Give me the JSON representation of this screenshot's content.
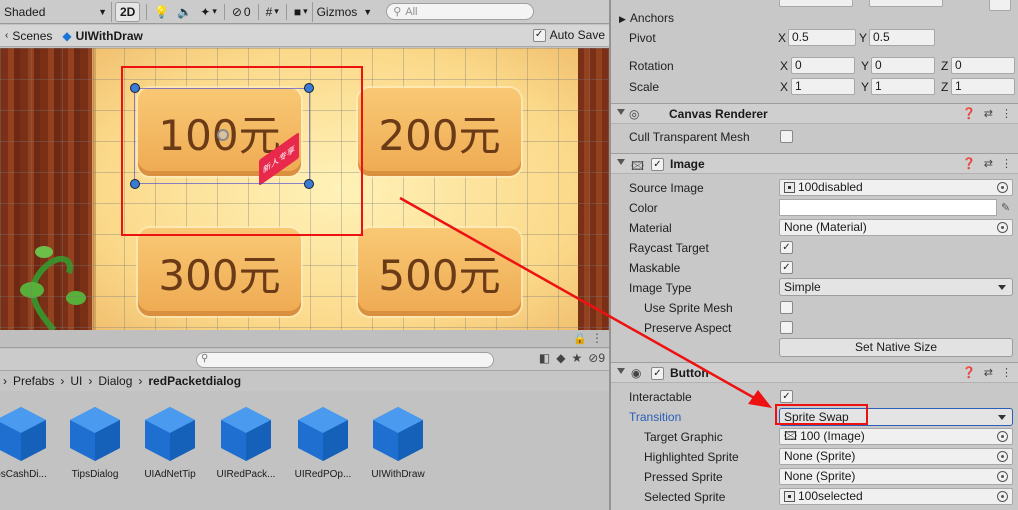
{
  "scene_toolbar": {
    "shading_mode": "Shaded",
    "mode_2d": "2D",
    "hidden_count": "0",
    "gizmos": "Gizmos",
    "search_placeholder": "All"
  },
  "breadcrumb": {
    "scenes": "Scenes",
    "prefab": "UIWithDraw",
    "autosave": "Auto Save"
  },
  "scene": {
    "buttons": [
      {
        "label": "100元"
      },
      {
        "label": "200元"
      },
      {
        "label": "300元"
      },
      {
        "label": "500元"
      }
    ],
    "badge": "新人专享"
  },
  "project": {
    "hidden_count": "9",
    "path": [
      "Prefabs",
      "UI",
      "Dialog",
      "redPacketdialog"
    ],
    "assets": [
      "psCashDi...",
      "TipsDialog",
      "UIAdNetTip",
      "UIRedPack...",
      "UIRedPOp...",
      "UIWithDraw"
    ]
  },
  "inspector": {
    "anchors": "Anchors",
    "pivot": {
      "label": "Pivot",
      "x": "0.5",
      "y": "0.5"
    },
    "rotation": {
      "label": "Rotation",
      "x": "0",
      "y": "0",
      "z": "0"
    },
    "scale": {
      "label": "Scale",
      "x": "1",
      "y": "1",
      "z": "1"
    },
    "axis_x": "X",
    "axis_y": "Y",
    "axis_z": "Z",
    "canvas_renderer": {
      "title": "Canvas Renderer",
      "cull_label": "Cull Transparent Mesh"
    },
    "image": {
      "title": "Image",
      "source_image_label": "Source Image",
      "source_image_value": "100disabled",
      "color_label": "Color",
      "material_label": "Material",
      "material_value": "None (Material)",
      "raycast_label": "Raycast Target",
      "maskable_label": "Maskable",
      "image_type_label": "Image Type",
      "image_type_value": "Simple",
      "use_sprite_mesh_label": "Use Sprite Mesh",
      "preserve_aspect_label": "Preserve Aspect",
      "set_native_size": "Set Native Size"
    },
    "button": {
      "title": "Button",
      "interactable_label": "Interactable",
      "transition_label": "Transition",
      "transition_value": "Sprite Swap",
      "target_graphic_label": "Target Graphic",
      "target_graphic_value": "100 (Image)",
      "highlighted_label": "Highlighted Sprite",
      "highlighted_value": "None (Sprite)",
      "pressed_label": "Pressed Sprite",
      "pressed_value": "None (Sprite)",
      "selected_label": "Selected Sprite",
      "selected_value": "100selected"
    }
  },
  "colors": {
    "annotation_red": "#e11111",
    "link_blue": "#2a5eb8",
    "unity_blue": "#1a73d9"
  }
}
